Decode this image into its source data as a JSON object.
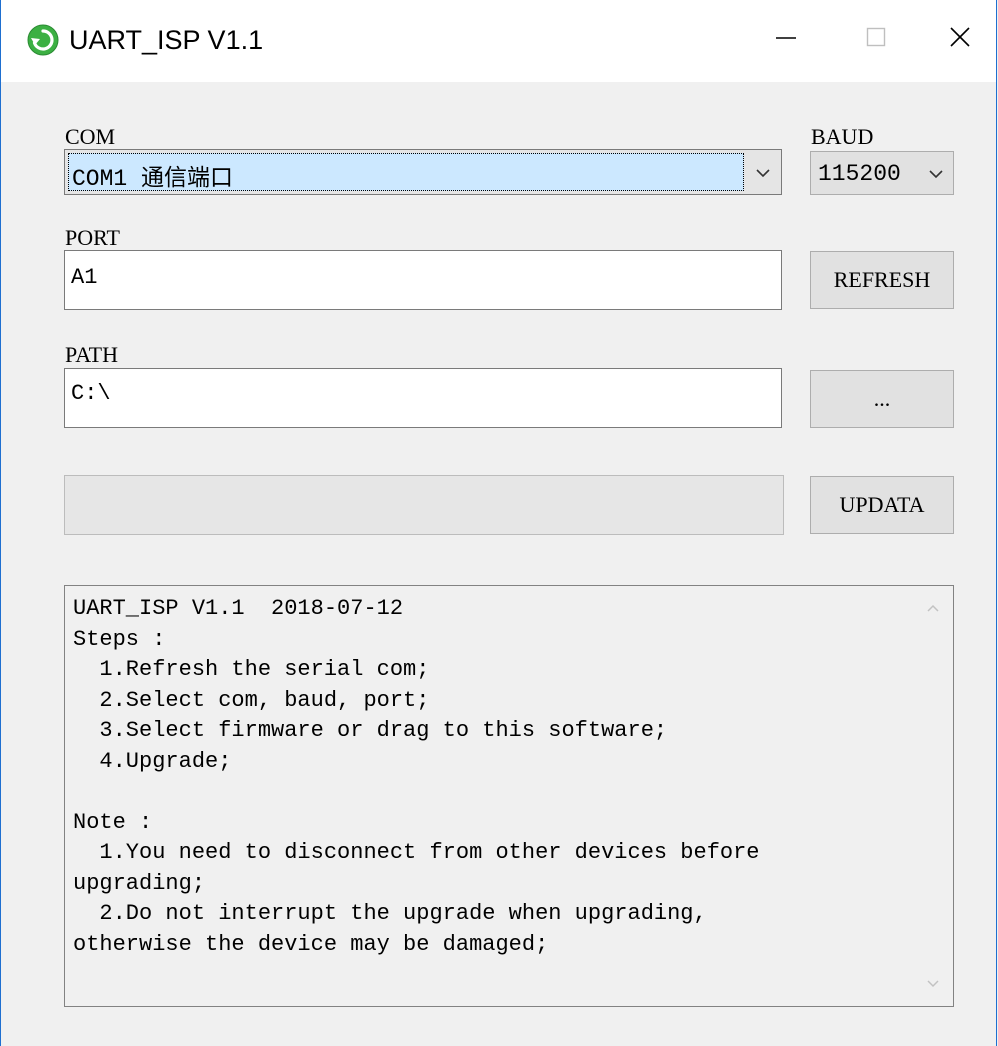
{
  "window": {
    "title": "UART_ISP V1.1"
  },
  "com": {
    "label": "COM",
    "value": "COM1 通信端口"
  },
  "baud": {
    "label": "BAUD",
    "value": "115200"
  },
  "port": {
    "label": "PORT",
    "value": "A1"
  },
  "refresh_button": {
    "label": "REFRESH"
  },
  "path": {
    "label": "PATH",
    "value": "C:\\"
  },
  "browse_button": {
    "label": "..."
  },
  "progress": {
    "fraction": 0
  },
  "update_button": {
    "label": "UPDATA"
  },
  "log": {
    "lines": [
      "UART_ISP V1.1  2018-07-12",
      "Steps :",
      "  1.Refresh the serial com;",
      "  2.Select com, baud, port;",
      "  3.Select firmware or drag to this software;",
      "  4.Upgrade;",
      "",
      "Note :",
      "  1.You need to disconnect from other devices before",
      "upgrading;",
      "  2.Do not interrupt the upgrade when upgrading,",
      "otherwise the device may be damaged;"
    ]
  },
  "icons": {
    "app": "refresh-arrow-icon",
    "minimize": "minimize-icon",
    "maximize": "maximize-icon",
    "close": "close-icon",
    "dropdown": "chevron-down-icon",
    "scroll_up": "scroll-up-arrow-icon",
    "scroll_down": "scroll-down-arrow-icon"
  },
  "colors": {
    "window_border": "#1e6fd0",
    "icon_green": "#3cb043",
    "focus_fill": "#cce8ff"
  }
}
